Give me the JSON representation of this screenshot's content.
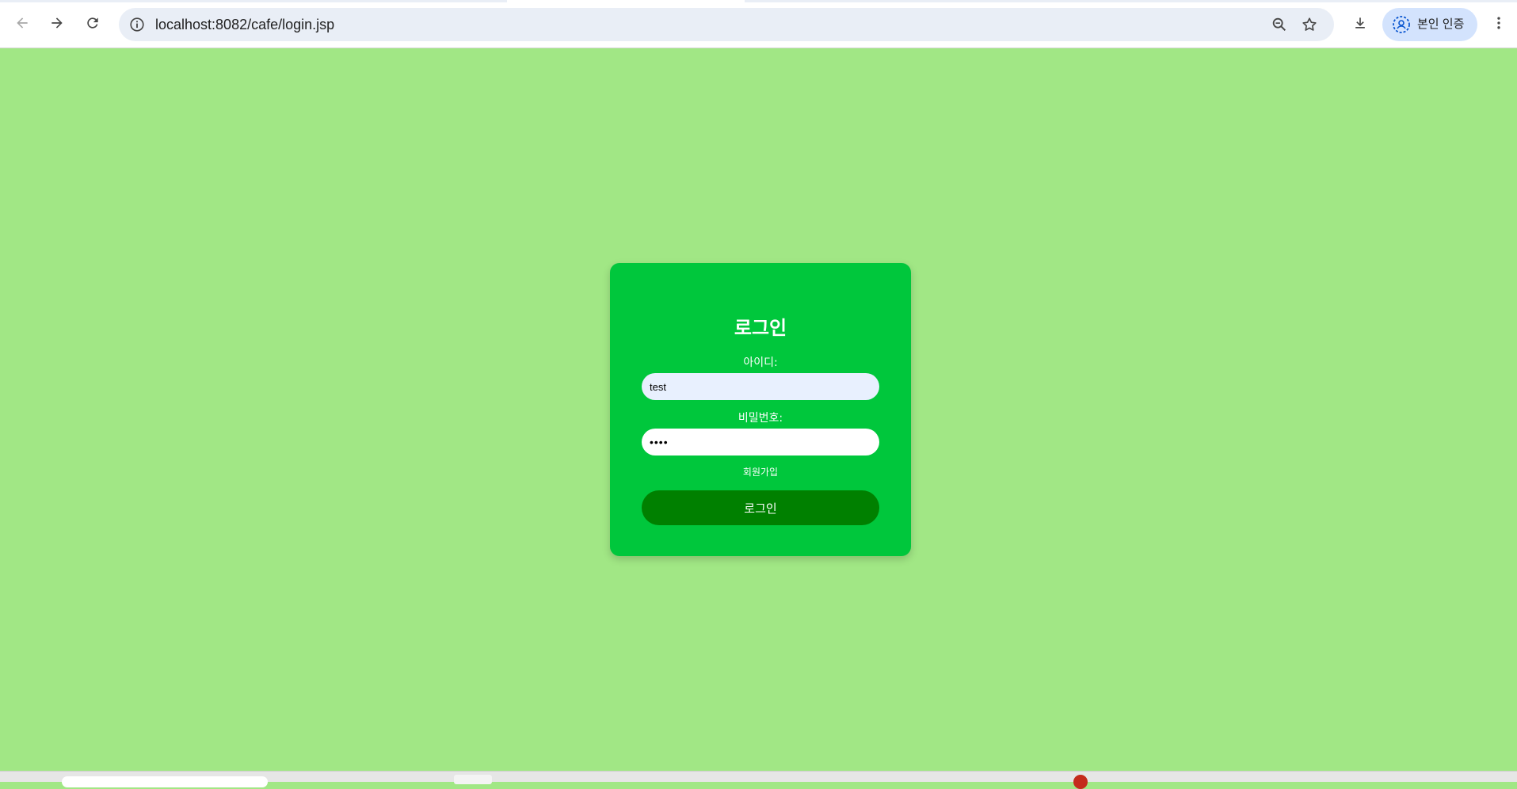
{
  "browser": {
    "url": "localhost:8082/cafe/login.jsp",
    "profile_label": "본인 인증",
    "icons": {
      "back": "arrow-left-icon",
      "forward": "arrow-right-icon",
      "reload": "reload-icon",
      "site_info": "info-icon",
      "zoom": "zoom-out-icon",
      "bookmark": "star-icon",
      "download": "download-icon",
      "profile": "profile-icon",
      "menu": "kebab-menu-icon"
    }
  },
  "login": {
    "title": "로그인",
    "id_label": "아이디:",
    "id_value": "test",
    "password_label": "비밀번호:",
    "password_value": "••••",
    "signup_link": "회원가입",
    "submit_label": "로그인"
  },
  "colors": {
    "page_background": "#a1e785",
    "card_background": "#00c73c",
    "button_background": "#008000",
    "input_filled_background": "#e8f0fe",
    "profile_chip": "#d3e3fd"
  }
}
